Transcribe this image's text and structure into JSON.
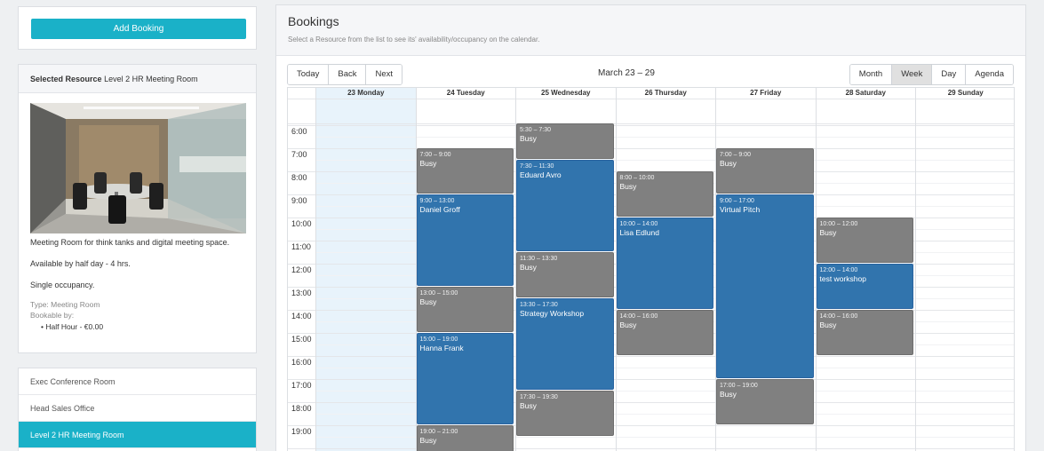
{
  "add_booking_label": "Add Booking",
  "selected": {
    "label": "Selected Resource",
    "name": "Level 2 HR Meeting Room",
    "description": "Meeting Room for think tanks and digital meeting space.",
    "availability": "Available by half day - 4 hrs.",
    "occupancy": "Single occupancy.",
    "type": "Type: Meeting Room",
    "bookable_label": "Bookable by:",
    "bookable_item": "Half Hour - €0.00"
  },
  "resources": [
    {
      "label": "Exec Conference Room",
      "active": false
    },
    {
      "label": "Head Sales Office",
      "active": false
    },
    {
      "label": "Level 2 HR Meeting Room",
      "active": true
    }
  ],
  "bookings": {
    "title": "Bookings",
    "subtitle": "Select a Resource from the list to see its' availability/occupancy on the calendar."
  },
  "toolbar": {
    "today": "Today",
    "back": "Back",
    "next": "Next",
    "range": "March 23 – 29",
    "views": [
      "Month",
      "Week",
      "Day",
      "Agenda"
    ],
    "active_view": "Week"
  },
  "calendar": {
    "days": [
      "23 Monday",
      "24 Tuesday",
      "25 Wednesday",
      "26 Thursday",
      "27 Friday",
      "28 Saturday",
      "29 Sunday"
    ],
    "hours": [
      "6:00",
      "7:00",
      "8:00",
      "9:00",
      "10:00",
      "11:00",
      "12:00",
      "13:00",
      "14:00",
      "15:00",
      "16:00",
      "17:00",
      "18:00",
      "19:00"
    ],
    "events": [
      {
        "day": 1,
        "start": 7,
        "end": 9,
        "time": "7:00 – 9:00",
        "title": "Busy",
        "kind": "gray"
      },
      {
        "day": 1,
        "start": 9,
        "end": 13,
        "time": "9:00 – 13:00",
        "title": "Daniel Groff",
        "kind": "blue"
      },
      {
        "day": 1,
        "start": 13,
        "end": 15,
        "time": "13:00 – 15:00",
        "title": "Busy",
        "kind": "gray"
      },
      {
        "day": 1,
        "start": 15,
        "end": 19,
        "time": "15:00 – 19:00",
        "title": "Hanna Frank",
        "kind": "blue"
      },
      {
        "day": 1,
        "start": 19,
        "end": 21,
        "time": "19:00 – 21:00",
        "title": "Busy",
        "kind": "gray"
      },
      {
        "day": 2,
        "start": 5.5,
        "end": 7.5,
        "time": "5:30 – 7:30",
        "title": "Busy",
        "kind": "gray"
      },
      {
        "day": 2,
        "start": 7.5,
        "end": 11.5,
        "time": "7:30 – 11:30",
        "title": "Eduard Avro",
        "kind": "blue"
      },
      {
        "day": 2,
        "start": 11.5,
        "end": 13.5,
        "time": "11:30 – 13:30",
        "title": "Busy",
        "kind": "gray"
      },
      {
        "day": 2,
        "start": 13.5,
        "end": 17.5,
        "time": "13:30 – 17:30",
        "title": "Strategy Workshop",
        "kind": "blue"
      },
      {
        "day": 2,
        "start": 17.5,
        "end": 19.5,
        "time": "17:30 – 19:30",
        "title": "Busy",
        "kind": "gray"
      },
      {
        "day": 3,
        "start": 8,
        "end": 10,
        "time": "8:00 – 10:00",
        "title": "Busy",
        "kind": "gray"
      },
      {
        "day": 3,
        "start": 10,
        "end": 14,
        "time": "10:00 – 14:00",
        "title": "Lisa Edlund",
        "kind": "blue"
      },
      {
        "day": 3,
        "start": 14,
        "end": 16,
        "time": "14:00 – 16:00",
        "title": "Busy",
        "kind": "gray"
      },
      {
        "day": 4,
        "start": 7,
        "end": 9,
        "time": "7:00 – 9:00",
        "title": "Busy",
        "kind": "gray"
      },
      {
        "day": 4,
        "start": 9,
        "end": 17,
        "time": "9:00 – 17:00",
        "title": "Virtual Pitch",
        "kind": "blue"
      },
      {
        "day": 4,
        "start": 17,
        "end": 19,
        "time": "17:00 – 19:00",
        "title": "Busy",
        "kind": "gray"
      },
      {
        "day": 5,
        "start": 10,
        "end": 12,
        "time": "10:00 – 12:00",
        "title": "Busy",
        "kind": "gray"
      },
      {
        "day": 5,
        "start": 12,
        "end": 14,
        "time": "12:00 – 14:00",
        "title": "test workshop",
        "kind": "blue"
      },
      {
        "day": 5,
        "start": 14,
        "end": 16,
        "time": "14:00 – 16:00",
        "title": "Busy",
        "kind": "gray"
      }
    ]
  }
}
